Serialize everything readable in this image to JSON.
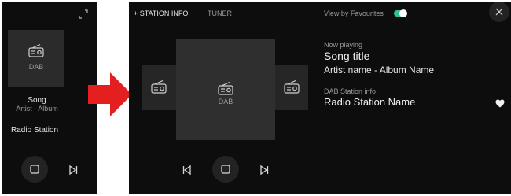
{
  "left": {
    "tile_label": "DAB",
    "song": "Song",
    "artist_album": "Artist - Album",
    "station": "Radio Station"
  },
  "right": {
    "tabs": [
      "+ STATION INFO",
      "TUNER"
    ],
    "view_fav_label": "View by Favourites",
    "center_tile_label": "DAB",
    "now_playing_label": "Now playing",
    "song_title": "Song title",
    "artist_album": "Artist name - Album Name",
    "dab_info_label": "DAB Station info",
    "station_name": "Radio Station Name"
  },
  "colors": {
    "arrow": "#e41f1f",
    "toggle": "#33c18c"
  }
}
